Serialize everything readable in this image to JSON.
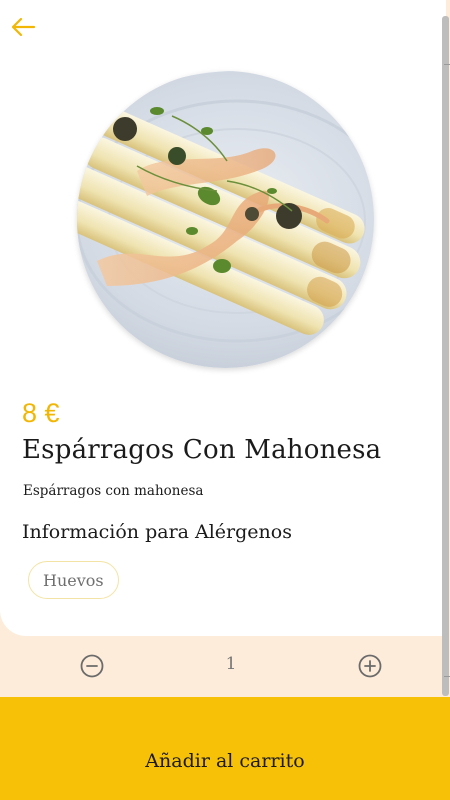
{
  "header": {
    "back_icon": "arrow-left-icon"
  },
  "product": {
    "image_icon": "asparagus-dish-photo",
    "price": "8 €",
    "name": "Espárragos Con Mahonesa",
    "description": "Espárragos con mahonesa"
  },
  "allergens": {
    "heading": "Información para Alérgenos",
    "items": [
      "Huevos"
    ]
  },
  "quantity": {
    "value": "1",
    "decrease_icon": "minus-circle-icon",
    "increase_icon": "plus-circle-icon"
  },
  "cart_button": {
    "label": "Añadir al carrito"
  },
  "colors": {
    "accent": "#f6c107",
    "price": "#f2b705",
    "background": "#fdecd9",
    "card": "#ffffff"
  }
}
